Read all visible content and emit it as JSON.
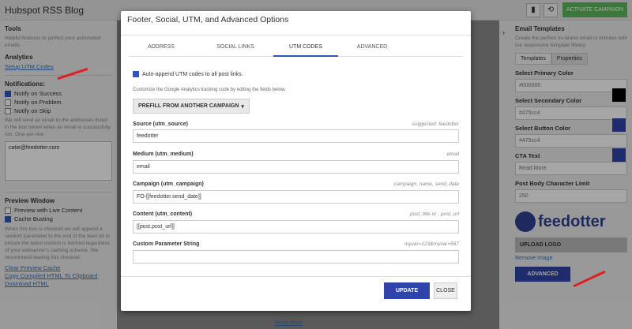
{
  "app": {
    "title": "Hubspot RSS Blog",
    "activate_label": "ACTIVATE CAMPAIGN"
  },
  "left": {
    "tools_heading": "Tools",
    "tools_desc": "Helpful features to perfect your automated emails.",
    "analytics_heading": "Analytics",
    "setup_utm_link": "Setup UTM Codes",
    "notifications_heading": "Notifications:",
    "notify": [
      {
        "label": "Notify on Success",
        "checked": true
      },
      {
        "label": "Notify on Problem",
        "checked": false
      },
      {
        "label": "Notify on Skip",
        "checked": false
      }
    ],
    "notify_desc": "We will send an email to the addresses listed in the box below when an email is successfully run. One-per-line.",
    "email_value": "catie@feedotter.com",
    "preview_heading": "Preview Window",
    "preview_live_label": "Preview with Live Content",
    "cache_busting_label": "Cache Busting",
    "cache_desc": "When this box is checked we will append a random parameter to the end of the feed url to ensure the latest content is fetched regardless of your webserver's caching scheme. We recommend leaving this checked.",
    "clear_cache_link": "Clear Preview Cache",
    "copy_html_link": "Copy Compiled HTML To Clipboard",
    "download_html_link": "Download HTML"
  },
  "right": {
    "heading": "Email Templates",
    "desc": "Create the perfect on-brand email in minutes with our responsive template library.",
    "tab_templates": "Templates",
    "tab_properties": "Properties",
    "primary_color_label": "Select Primary Color",
    "primary_color_value": "#000000",
    "secondary_color_label": "Select Secondary Color",
    "secondary_color_value": "#475cc4",
    "button_color_label": "Select Button Color",
    "button_color_value": "#475cc4",
    "cta_label": "CTA Text",
    "cta_value": "Read More",
    "body_limit_label": "Post Body Character Limit",
    "body_limit_value": "250",
    "logo_text": "feedotter",
    "upload_logo": "UPLOAD LOGO",
    "remove_image": "Remove Image",
    "advanced_button": "ADVANCED"
  },
  "page": {
    "read_more": "Read More"
  },
  "modal": {
    "title": "Footer, Social, UTM, and Advanced Options",
    "tabs": [
      "ADDRESS",
      "SOCIAL LINKS",
      "UTM CODES",
      "ADVANCED"
    ],
    "auto_append_label": "Auto-append UTM codes to all post links.",
    "customize_desc": "Customize the Google Analytics tracking code by editing the fields below.",
    "prefill_label": "PREFILL FROM ANOTHER CAMPAIGN",
    "fields": [
      {
        "label": "Source (utm_source)",
        "hint": "suggested: feedotter",
        "value": "feedotter"
      },
      {
        "label": "Medium (utm_medium)",
        "hint": "email",
        "value": "email"
      },
      {
        "label": "Campaign (utm_campaign)",
        "hint": "campaign_name, send_date",
        "value": "FO-[[feedotter.send_date]]"
      },
      {
        "label": "Content (utm_content)",
        "hint": "post_title or , post_url",
        "value": "[[post.post_url]]"
      },
      {
        "label": "Custom Parameter String",
        "hint": "myvar=123&myvar=567",
        "value": ""
      }
    ],
    "update_label": "UPDATE",
    "close_label": "CLOSE"
  },
  "colors": {
    "accent": "#2f44a8",
    "green": "#5cb85c",
    "arrow": "#e02020"
  }
}
